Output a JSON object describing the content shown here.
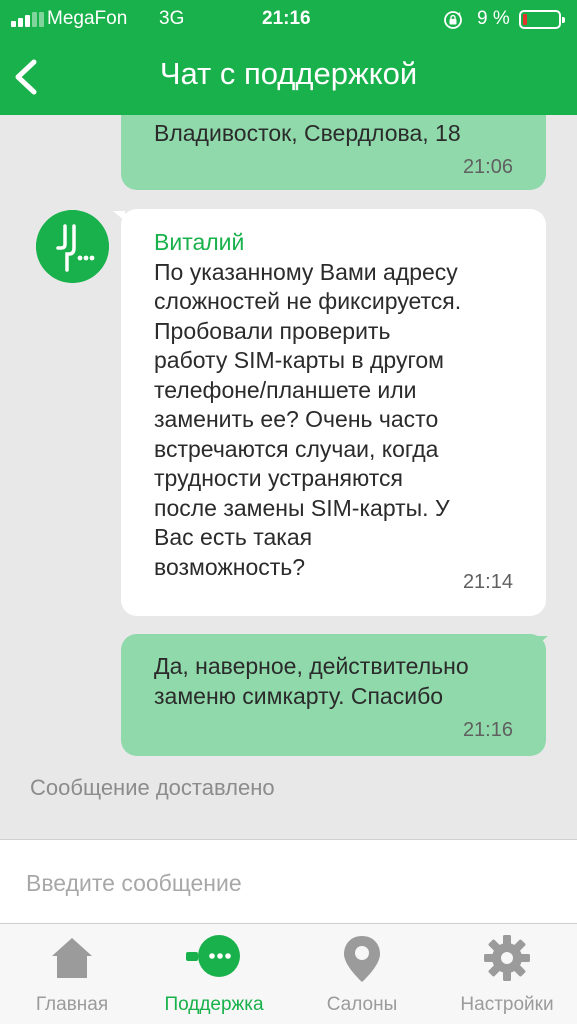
{
  "status_bar": {
    "carrier": "MegaFon",
    "network": "3G",
    "time": "21:16",
    "battery_percent": "9 %",
    "battery_level": 0.09,
    "lock_icon": "orientation-lock-icon"
  },
  "nav": {
    "title": "Чат с поддержкой",
    "back_icon": "chevron-left-icon"
  },
  "messages": [
    {
      "direction": "outgoing",
      "partial_top": true,
      "text": "Владивосток, Свердлова, 18",
      "time": "21:06"
    },
    {
      "direction": "incoming",
      "sender": "Виталий",
      "avatar_icon": "megafon-logo-icon",
      "lines": [
        "По указанному Вами адресу",
        "сложностей не фиксируется.",
        "Пробовали проверить",
        "работу SIM-карты в другом",
        "телефоне/планшете или",
        "заменить ее? Очень часто",
        "встречаются случаи, когда",
        "трудности устраняются",
        "после замены SIM-карты. У",
        "Вас есть такая",
        "возможность?"
      ],
      "time": "21:14"
    },
    {
      "direction": "outgoing",
      "lines": [
        "Да, наверное, действительно",
        "заменю симкарту. Спасибо"
      ],
      "time": "21:16"
    }
  ],
  "delivery_status": "Сообщение доставлено",
  "composer": {
    "placeholder": "Введите сообщение",
    "value": ""
  },
  "tabs": [
    {
      "label": "Главная",
      "icon": "home-icon",
      "active": false
    },
    {
      "label": "Поддержка",
      "icon": "chat-bubble-icon",
      "active": true
    },
    {
      "label": "Салоны",
      "icon": "map-pin-icon",
      "active": false
    },
    {
      "label": "Настройки",
      "icon": "gear-icon",
      "active": false
    }
  ],
  "colors": {
    "brand_green": "#19b14b",
    "outgoing_bubble": "#8fd9ab",
    "incoming_bubble": "#ffffff",
    "inactive_tab": "#9b9b9b"
  }
}
